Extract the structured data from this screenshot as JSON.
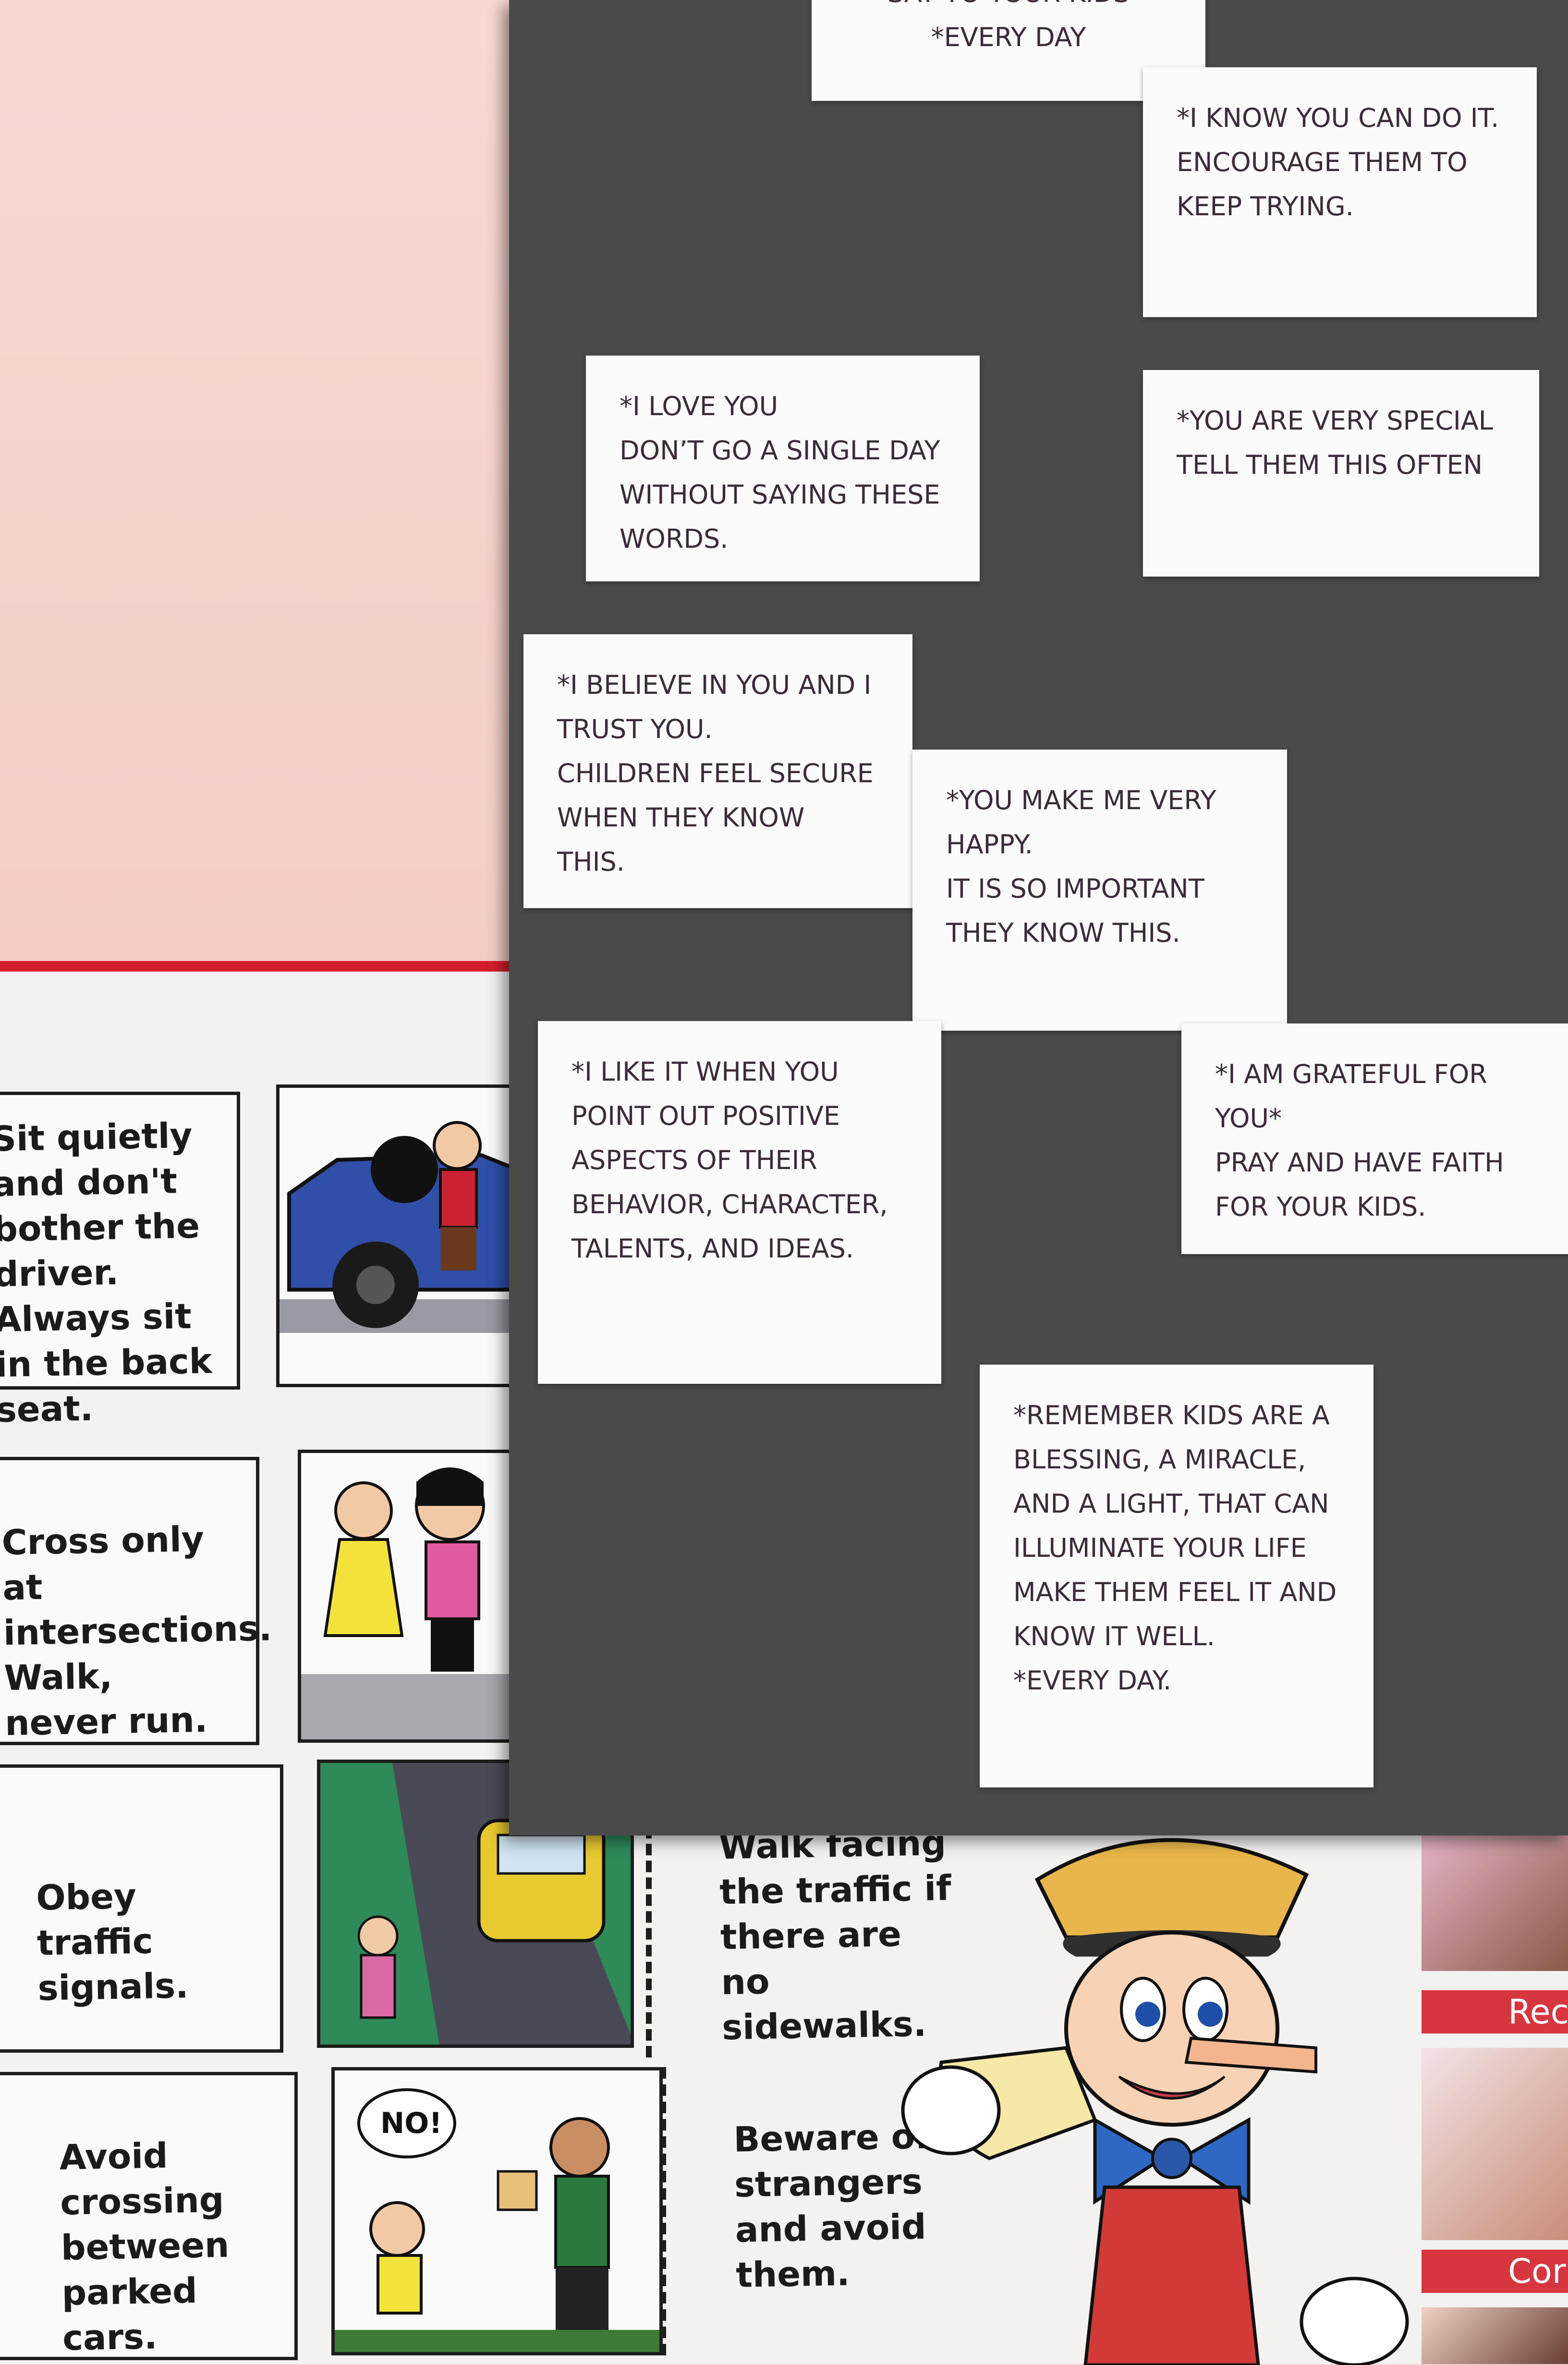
{
  "notes": [
    {
      "id": "top-partial",
      "text": "SAY TO YOUR KIDS\n*EVERY DAY"
    },
    {
      "id": "know-you-can",
      "text": "*I KNOW YOU CAN DO IT.\nENCOURAGE THEM TO KEEP TRYING."
    },
    {
      "id": "love-you",
      "text": "*I LOVE YOU\nDON’T GO A SINGLE DAY WITHOUT SAYING THESE WORDS."
    },
    {
      "id": "very-special",
      "text": "*YOU ARE VERY SPECIAL\nTELL THEM THIS OFTEN"
    },
    {
      "id": "believe-in-you",
      "text": "*I BELIEVE IN YOU AND I TRUST YOU.\nCHILDREN FEEL SECURE WHEN THEY KNOW THIS."
    },
    {
      "id": "very-happy",
      "text": "*YOU MAKE ME VERY HAPPY.\nIT IS SO  IMPORTANT THEY KNOW THIS."
    },
    {
      "id": "like-it",
      "text": "*I LIKE IT WHEN YOU POINT OUT POSITIVE ASPECTS OF THEIR BEHAVIOR, CHARACTER, TALENTS, AND IDEAS."
    },
    {
      "id": "grateful",
      "text": "*I AM GRATEFUL FOR YOU*\nPRAY AND HAVE FAITH FOR YOUR KIDS."
    },
    {
      "id": "remember-kids",
      "text": "*REMEMBER KIDS ARE A BLESSING, A MIRACLE, AND A LIGHT, THAT CAN ILLUMINATE YOUR LIFE MAKE THEM FEEL IT AND KNOW IT WELL.\n*EVERY DAY."
    }
  ],
  "safety_rules": {
    "sit_quietly": "Sit quietly and don't bother the driver. Always sit in the back seat.",
    "cross": "Cross only at intersections. Walk, never run.",
    "obey": "Obey traffic signals.",
    "walk_facing": "Walk facing the traffic if there are no sidewalks.",
    "avoid": "Avoid crossing between parked cars.",
    "beware": "Beware of strangers and avoid them.",
    "speech_bubble": "NO!"
  },
  "banners": {
    "first": "Rec",
    "second": "Cor"
  },
  "colors": {
    "board": "#4a4a4a",
    "wall": "#f3ccc7",
    "poster_border": "#d21f2a",
    "car": "#2f4fa8",
    "taxi": "#e9c930"
  }
}
